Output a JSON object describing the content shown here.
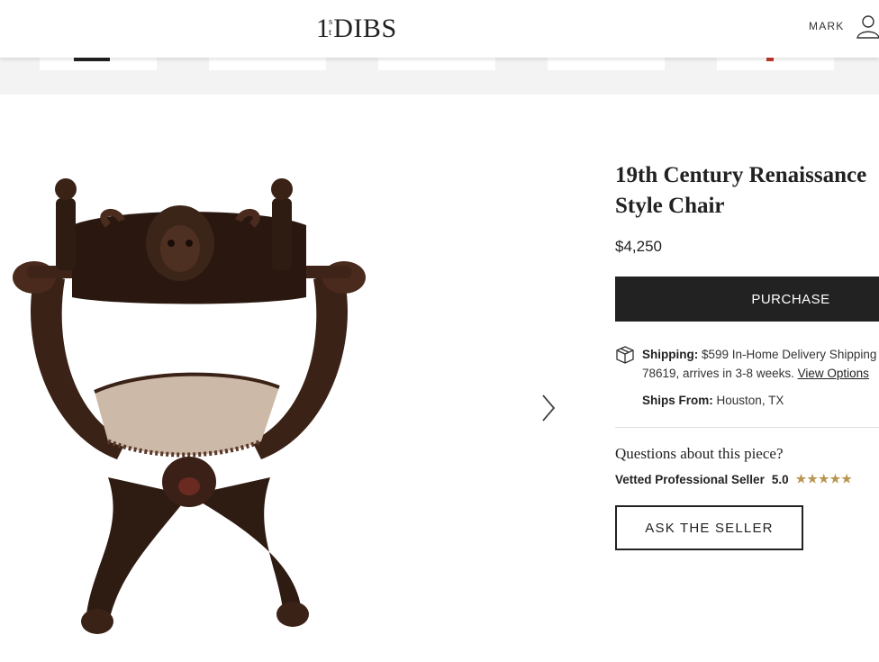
{
  "header": {
    "logo_number": "1",
    "logo_sup_top": "s",
    "logo_sup_bottom": "t",
    "logo_word": "DIBS",
    "account_name": "MARK"
  },
  "product": {
    "title": "19th Century Renaissance Style Chair",
    "price": "$4,250",
    "purchase_label": "PURCHASE"
  },
  "shipping": {
    "label": "Shipping:",
    "text": "$599 In-Home Delivery Shipping",
    "text_line2": "78619, arrives in 3-8 weeks.",
    "view_options": "View Options",
    "ships_from_label": "Ships From:",
    "ships_from_value": "Houston, TX"
  },
  "seller": {
    "questions": "Questions about this piece?",
    "badge": "Vetted Professional Seller",
    "rating": "5.0",
    "stars": "★★★★★",
    "ask_label": "ASK THE SELLER"
  },
  "colors": {
    "dark": "#222222",
    "gold_stars": "#b89550",
    "strip_bg": "#f3f3f3"
  }
}
